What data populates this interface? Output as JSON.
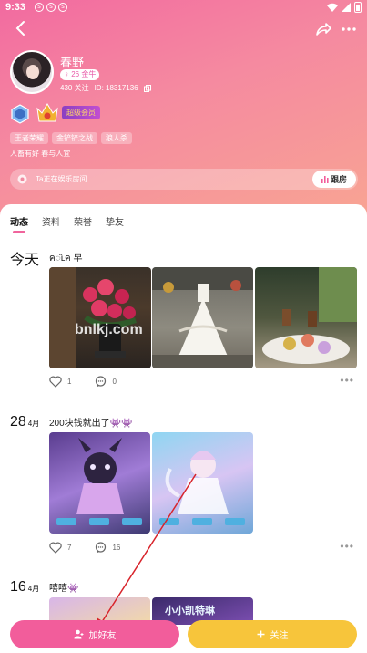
{
  "status": {
    "time": "9:33",
    "notif_icons": [
      "s",
      "s",
      "s"
    ]
  },
  "profile": {
    "username": "春野",
    "level_badge": "♀ 26 金牛",
    "follows": "430 关注",
    "id_text": "ID: 18317136",
    "vip": "超级会员",
    "tags": [
      "王者荣耀",
      "金铲铲之战",
      "狼人杀"
    ],
    "bio": "人畜有好 春与人宜",
    "room_text": "Ta正在娱乐房间",
    "room_button": "跟房"
  },
  "tabs": [
    {
      "label": "动态",
      "active": true
    },
    {
      "label": "资料",
      "active": false
    },
    {
      "label": "荣誉",
      "active": false
    },
    {
      "label": "挚友",
      "active": false
    }
  ],
  "posts": [
    {
      "day": "今天",
      "month": "",
      "title": "ค◌̂ւค 早",
      "likes": "1",
      "comments": "0"
    },
    {
      "day": "28",
      "month": "4月",
      "title": "200块钱就出了👾👾",
      "likes": "7",
      "comments": "16"
    },
    {
      "day": "16",
      "month": "4月",
      "title": "嘻嘻👾",
      "overlay": "小小凯特琳"
    }
  ],
  "watermark": "bnlkj.com",
  "bottom": {
    "add_friend": "加好友",
    "follow": "关注"
  }
}
